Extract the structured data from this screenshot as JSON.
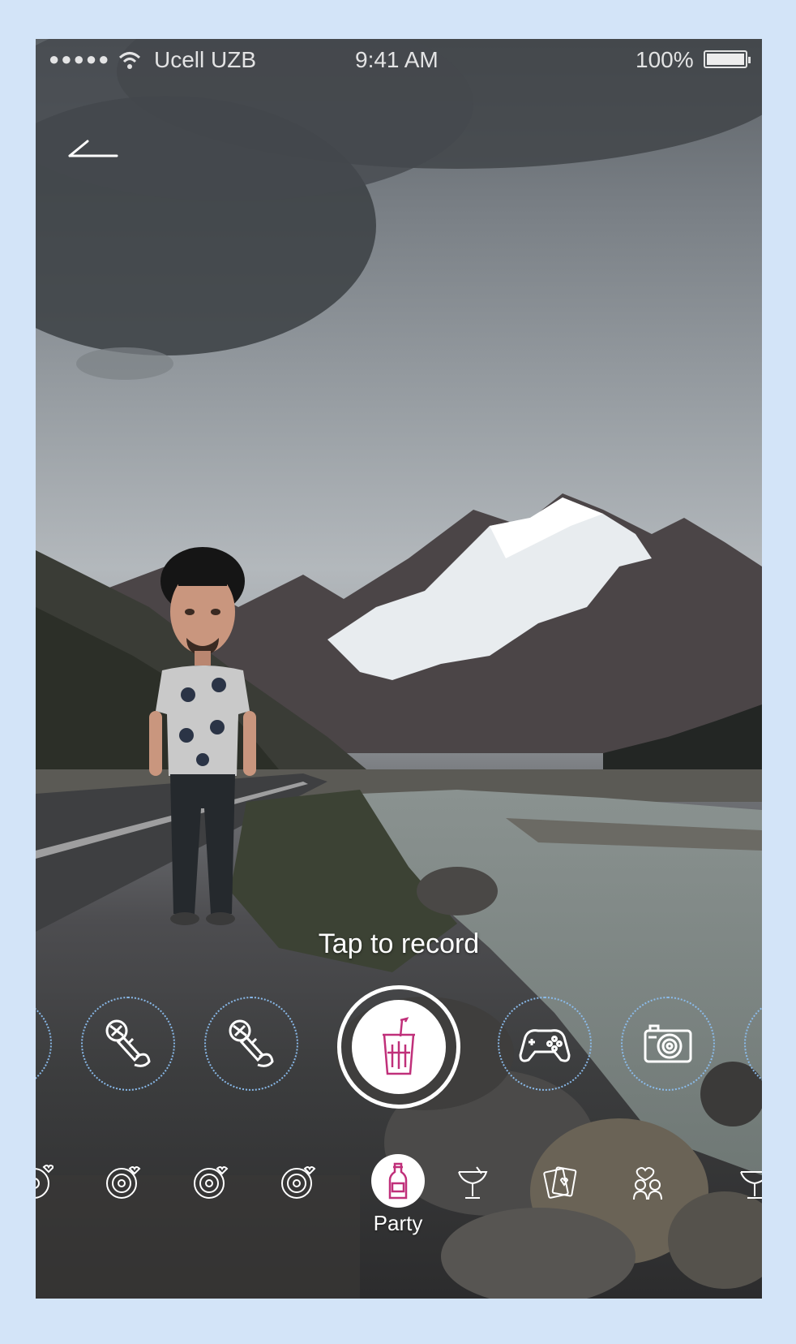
{
  "status_bar": {
    "signal_dots": "●●●●●",
    "carrier": "Ucell UZB",
    "time": "9:41 AM",
    "battery_text": "100%",
    "battery_level": 1.0
  },
  "record": {
    "hint": "Tap to record"
  },
  "effects": [
    {
      "icon": "microphone-icon"
    },
    {
      "icon": "microphone-icon"
    },
    {
      "icon": "soda-cup-icon",
      "selected": true
    },
    {
      "icon": "gamepad-icon"
    },
    {
      "icon": "camera-icon"
    }
  ],
  "categories": {
    "active_label": "Party",
    "items": [
      {
        "icon": "heart-disc-icon"
      },
      {
        "icon": "heart-disc-icon"
      },
      {
        "icon": "heart-disc-icon"
      },
      {
        "icon": "heart-disc-icon"
      },
      {
        "icon": "bottle-icon",
        "label": "Party",
        "active": true
      },
      {
        "icon": "cocktail-glass-icon"
      },
      {
        "icon": "cards-icon"
      },
      {
        "icon": "couple-icon"
      },
      {
        "icon": "cocktail-glass-icon"
      }
    ]
  },
  "colors": {
    "page_background": "#d3e4f8",
    "accent": "#c0307a",
    "effect_ring": "#8cbef0"
  }
}
